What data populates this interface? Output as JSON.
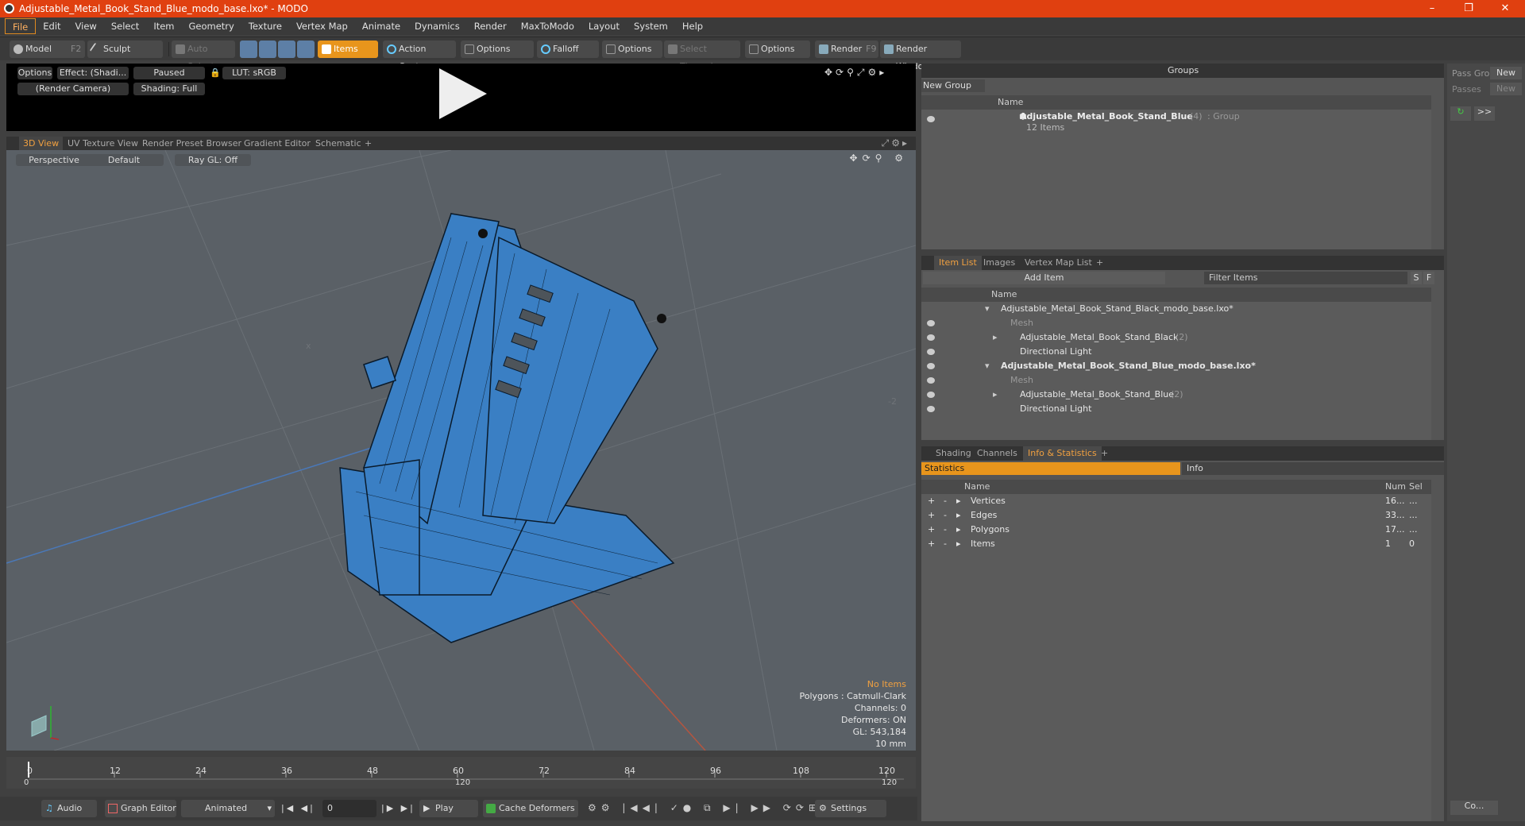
{
  "window": {
    "title": "Adjustable_Metal_Book_Stand_Blue_modo_base.lxo* - MODO",
    "minimize": "–",
    "maximize": "❐",
    "close": "✕"
  },
  "menu": [
    "File",
    "Edit",
    "View",
    "Select",
    "Item",
    "Geometry",
    "Texture",
    "Vertex Map",
    "Animate",
    "Dynamics",
    "Render",
    "MaxToModo",
    "Layout",
    "System",
    "Help"
  ],
  "toolbar": {
    "model": "Model",
    "model_key": "F2",
    "sculpt": "Sculpt",
    "auto_select": "Auto Select",
    "items": "Items",
    "action_center": "Action Center",
    "options1": "Options",
    "falloff": "Falloff",
    "options2": "Options",
    "select_through": "Select Through",
    "options3": "Options",
    "render": "Render",
    "render_key": "F9",
    "render_window": "Render Window"
  },
  "preview": {
    "options": "Options",
    "effect": "Effect: (Shadi...",
    "paused": "Paused",
    "lut": "LUT: sRGB",
    "camera": "(Render Camera)",
    "shading": "Shading: Full"
  },
  "view_tabs": [
    "3D View",
    "UV Texture View",
    "Render Preset Browser",
    "Gradient Editor",
    "Schematic",
    "+"
  ],
  "viewport": {
    "projection": "Perspective",
    "style": "Default",
    "raygl": "Ray GL: Off",
    "axis_x": "x",
    "axis_neg2": "-2",
    "hud": {
      "selection": "No Items",
      "polygons": "Polygons : Catmull-Clark",
      "channels": "Channels: 0",
      "deformers": "Deformers: ON",
      "gl": "GL: 543,184",
      "unit": "10 mm"
    }
  },
  "timeline": {
    "ticks": [
      "0",
      "12",
      "24",
      "36",
      "48",
      "60",
      "72",
      "84",
      "96",
      "108",
      "120"
    ],
    "range_start": "0",
    "range_mid": "120",
    "range_end": "120"
  },
  "bottom": {
    "audio": "Audio",
    "graph_editor": "Graph Editor",
    "animated": "Animated",
    "frame": "0",
    "play": "Play",
    "cache_deformers": "Cache Deformers",
    "settings": "Settings"
  },
  "groups": {
    "title": "Groups",
    "new_group": "New Group",
    "col_name": "Name",
    "item_name": "Adjustable_Metal_Book_Stand_Blue",
    "item_count": "(4)",
    "item_type": ": Group",
    "item_sub": "12 Items"
  },
  "pass": {
    "pass_groups": "Pass Gro",
    "new1": "New",
    "passes": "Passes",
    "new2": "New",
    "more": ">>",
    "co": "Co..."
  },
  "item_list": {
    "tabs": [
      "Item List",
      "Images",
      "Vertex Map List",
      "+"
    ],
    "add_item": "Add Item",
    "filter": "Filter Items",
    "s": "S",
    "f": "F",
    "col_name": "Name",
    "rows": [
      {
        "label": "Adjustable_Metal_Book_Stand_Black_modo_base.lxo*",
        "count": "",
        "bold": false,
        "indent": 0
      },
      {
        "label": "Mesh",
        "count": "",
        "bold": false,
        "indent": 1,
        "dim": true
      },
      {
        "label": "Adjustable_Metal_Book_Stand_Black",
        "count": "(2)",
        "bold": false,
        "indent": 1
      },
      {
        "label": "Directional Light",
        "count": "",
        "bold": false,
        "indent": 1
      },
      {
        "label": "Adjustable_Metal_Book_Stand_Blue_modo_base.lxo*",
        "count": "",
        "bold": true,
        "indent": 0
      },
      {
        "label": "Mesh",
        "count": "",
        "bold": false,
        "indent": 1,
        "dim": true
      },
      {
        "label": "Adjustable_Metal_Book_Stand_Blue",
        "count": "(2)",
        "bold": false,
        "indent": 1
      },
      {
        "label": "Directional Light",
        "count": "",
        "bold": false,
        "indent": 1
      }
    ]
  },
  "stats": {
    "tabs": [
      "Shading",
      "Channels",
      "Info & Statistics",
      "+"
    ],
    "statistics": "Statistics",
    "info": "Info",
    "col_name": "Name",
    "col_num": "Num",
    "col_sel": "Sel",
    "rows": [
      {
        "name": "Vertices",
        "num": "16...",
        "sel": "..."
      },
      {
        "name": "Edges",
        "num": "33...",
        "sel": "..."
      },
      {
        "name": "Polygons",
        "num": "17...",
        "sel": "..."
      },
      {
        "name": "Items",
        "num": "1",
        "sel": "0"
      }
    ]
  },
  "colors": {
    "accent": "#e8951c",
    "title_bar": "#e04010",
    "mesh_blue": "#3a7fc4"
  }
}
